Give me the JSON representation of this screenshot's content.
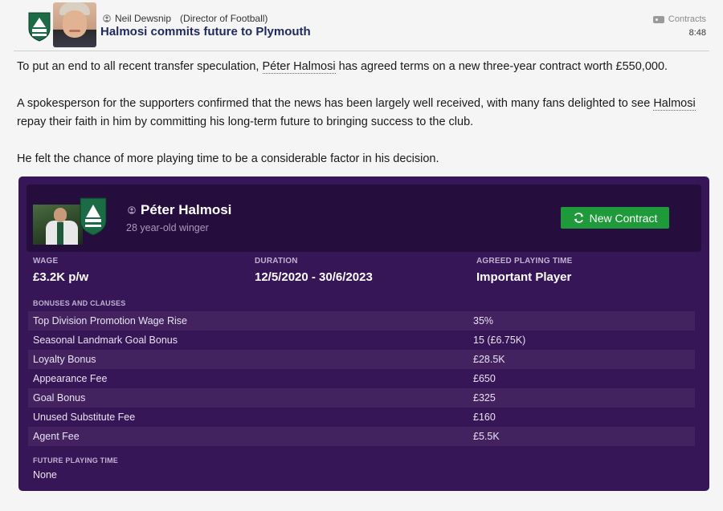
{
  "header": {
    "sender_name": "Neil Dewsnip",
    "sender_role": "(Director of Football)",
    "subject": "Halmosi commits future to Plymouth",
    "tag": "Contracts",
    "time": "8:48"
  },
  "body": {
    "p1_before": "To put an end to all recent transfer speculation, ",
    "p1_link": "Péter Halmosi",
    "p1_after": " has agreed terms on a new three-year contract worth £550,000.",
    "p2_before": "A spokesperson for the supporters confirmed that the news has been largely well received, with many fans delighted to see ",
    "p2_link": "Halmosi",
    "p2_after": " repay their faith in him by committing his long-term future to bringing success to the club.",
    "p3": "He felt the chance of more playing time to be a considerable factor in his decision."
  },
  "card": {
    "player_name": "Péter Halmosi",
    "player_sub": "28 year-old winger",
    "button_label": "New Contract",
    "wage_label": "WAGE",
    "wage_value": "£3.2K p/w",
    "duration_label": "DURATION",
    "duration_value": "12/5/2020 - 30/6/2023",
    "playing_time_label": "AGREED PLAYING TIME",
    "playing_time_value": "Important Player",
    "bonuses_label": "BONUSES AND CLAUSES",
    "bonuses": [
      {
        "name": "Top Division Promotion Wage Rise",
        "value": "35%"
      },
      {
        "name": "Seasonal Landmark Goal Bonus",
        "value": "15 (£6.75K)"
      },
      {
        "name": "Loyalty Bonus",
        "value": "£28.5K"
      },
      {
        "name": "Appearance Fee",
        "value": "£650"
      },
      {
        "name": "Goal Bonus",
        "value": "£325"
      },
      {
        "name": "Unused Substitute Fee",
        "value": "£160"
      },
      {
        "name": "Agent Fee",
        "value": "£5.5K"
      }
    ],
    "future_label": "FUTURE PLAYING TIME",
    "future_value": "None"
  },
  "icons": {
    "person": "person-icon",
    "tag": "tag-icon",
    "refresh": "refresh-icon",
    "badge": "club-badge"
  },
  "colors": {
    "card_bg": "#371657",
    "card_header_bg": "#250d3d",
    "button_green": "#1e9a3a",
    "subject_blue": "#1e2a5a"
  }
}
